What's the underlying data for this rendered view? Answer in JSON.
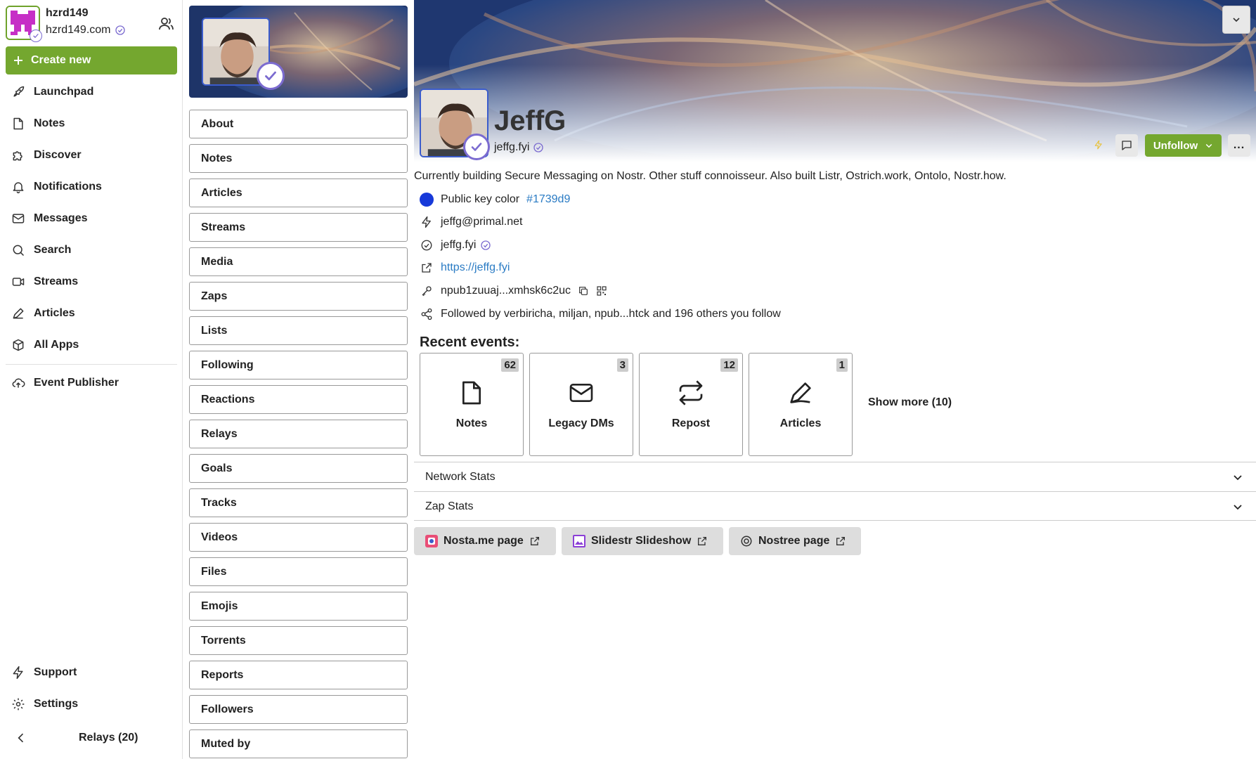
{
  "account": {
    "name": "hzrd149",
    "nip05": "hzrd149.com"
  },
  "sidebar": {
    "create_label": "Create new",
    "items": [
      {
        "label": "Launchpad",
        "icon": "rocket-icon"
      },
      {
        "label": "Notes",
        "icon": "note-icon"
      },
      {
        "label": "Discover",
        "icon": "puzzle-icon"
      },
      {
        "label": "Notifications",
        "icon": "bell-icon"
      },
      {
        "label": "Messages",
        "icon": "mail-icon"
      },
      {
        "label": "Search",
        "icon": "search-icon"
      },
      {
        "label": "Streams",
        "icon": "video-icon"
      },
      {
        "label": "Articles",
        "icon": "pen-icon"
      },
      {
        "label": "All Apps",
        "icon": "box-icon"
      }
    ],
    "publisher_label": "Event Publisher",
    "support_label": "Support",
    "settings_label": "Settings",
    "relays_label": "Relays (20)"
  },
  "sections": [
    "About",
    "Notes",
    "Articles",
    "Streams",
    "Media",
    "Zaps",
    "Lists",
    "Following",
    "Reactions",
    "Relays",
    "Goals",
    "Tracks",
    "Videos",
    "Files",
    "Emojis",
    "Torrents",
    "Reports",
    "Followers",
    "Muted by"
  ],
  "profile": {
    "name": "JeffG",
    "nip05": "jeffg.fyi",
    "unfollow_label": "Unfollow",
    "more_label": "...",
    "bio": "Currently building Secure Messaging on Nostr. Other stuff connoisseur. Also built Listr, Ostrich.work, Ontolo, Nostr.how.",
    "pubkey_color_label": "Public key color",
    "pubkey_color": "#1739d9",
    "lightning": "jeffg@primal.net",
    "nip05_row": "jeffg.fyi",
    "website": "https://jeffg.fyi",
    "npub": "npub1zuuaj...xmhsk6c2uc",
    "followed_by": "Followed by verbiricha, miljan, npub...htck and 196 others you follow"
  },
  "recent": {
    "title": "Recent events:",
    "cards": [
      {
        "label": "Notes",
        "count": "62",
        "icon": "note-icon"
      },
      {
        "label": "Legacy DMs",
        "count": "3",
        "icon": "mail-icon"
      },
      {
        "label": "Repost",
        "count": "12",
        "icon": "repost-icon"
      },
      {
        "label": "Articles",
        "count": "1",
        "icon": "pen-icon"
      }
    ],
    "show_more": "Show more (10)"
  },
  "accordions": [
    "Network Stats",
    "Zap Stats"
  ],
  "external_links": [
    {
      "label": "Nosta.me page",
      "icon": "nosta-icon"
    },
    {
      "label": "Slidestr Slideshow",
      "icon": "image-icon"
    },
    {
      "label": "Nostree page",
      "icon": "nostree-icon"
    }
  ],
  "colors": {
    "accent": "#74a72f",
    "verified": "#7b6bd0",
    "link": "#2a7bc4",
    "avatar_border": "#3b5ccc"
  }
}
